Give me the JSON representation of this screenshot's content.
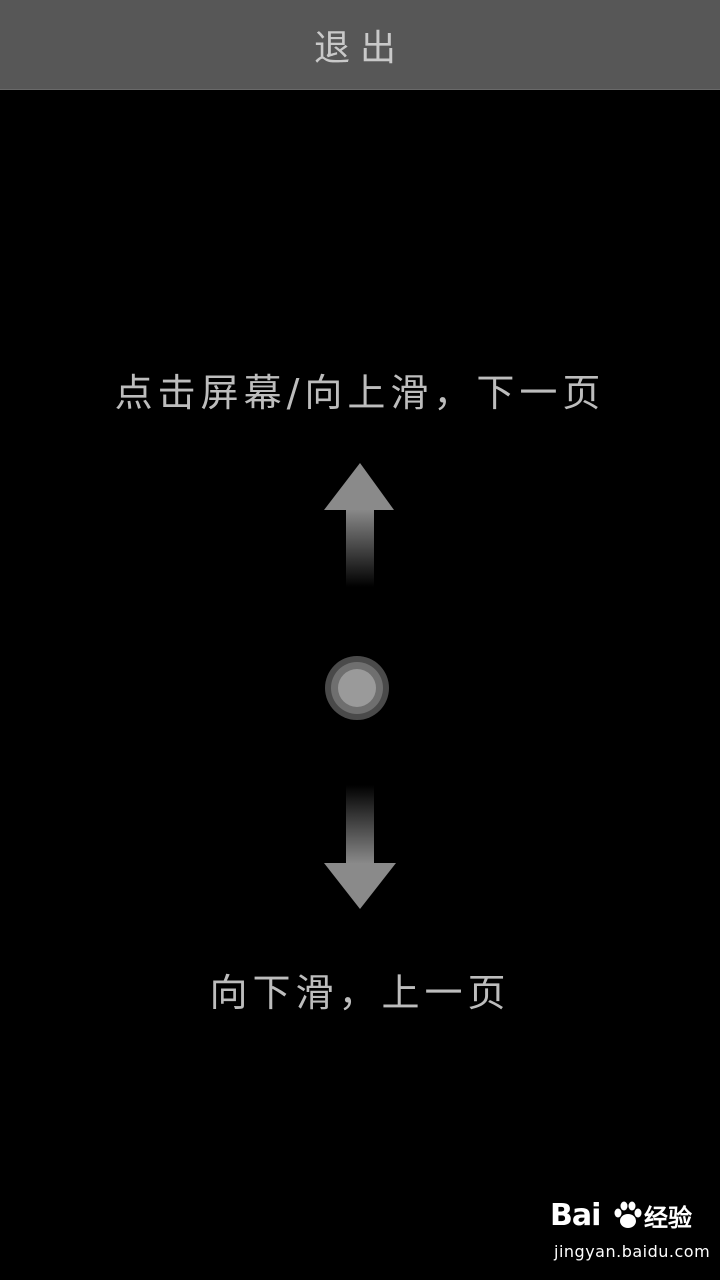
{
  "topbar": {
    "exit_label": "退出"
  },
  "hints": {
    "next_page": "点击屏幕/向上滑，下一页",
    "prev_page": "向下滑，上一页"
  },
  "icons": {
    "arrow_up": "arrow-up-icon",
    "arrow_down": "arrow-down-icon",
    "touch_point": "touch-point-icon",
    "paw": "paw-icon"
  },
  "watermark": {
    "logo_left": "Bai",
    "logo_right": "经验",
    "url": "jingyan.baidu.com"
  },
  "colors": {
    "background": "#000000",
    "topbar": "#575757",
    "text": "#bdbdbd"
  }
}
